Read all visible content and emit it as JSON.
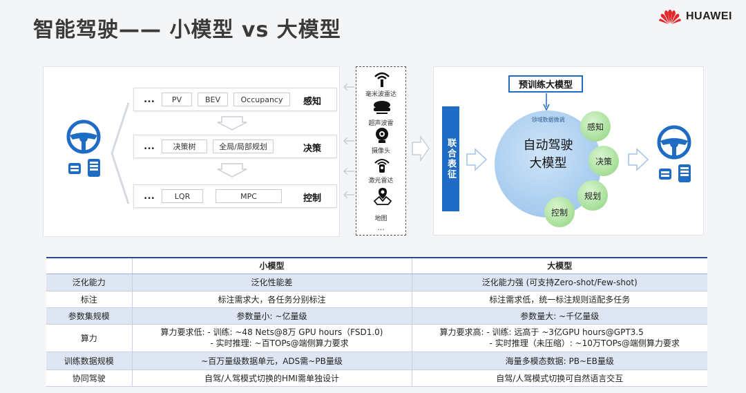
{
  "header": {
    "title": "智能驾驶—— 小模型 vs 大模型",
    "brand": "HUAWEI"
  },
  "small_model_stack": {
    "rows": [
      {
        "dots": "...",
        "chips": [
          "PV",
          "BEV",
          "Occupancy"
        ],
        "label": "感知"
      },
      {
        "dots": "...",
        "chips": [
          "决策树",
          "全局/局部规划"
        ],
        "label": "决策"
      },
      {
        "dots": "...",
        "chips": [
          "LQR",
          "MPC"
        ],
        "label": "控制"
      }
    ]
  },
  "sensors": {
    "items": [
      {
        "label": "毫米波雷达",
        "icon": "radar-icon"
      },
      {
        "label": "超声波雷",
        "icon": "ultrasonic-icon"
      },
      {
        "label": "摄像头",
        "icon": "camera-icon"
      },
      {
        "label": "激光雷达",
        "icon": "lidar-icon"
      },
      {
        "label": "地图",
        "icon": "map-icon"
      }
    ],
    "more": "..."
  },
  "large_model": {
    "joint": "联合表征",
    "pretrain": "预训练大模型",
    "domain_tune": "领域数据微调",
    "title_line1": "自动驾驶",
    "title_line2": "大模型",
    "tasks": [
      "感知",
      "决策",
      "规划",
      "控制"
    ]
  },
  "comparison": {
    "headers": [
      "",
      "小模型",
      "大模型"
    ],
    "rows": [
      {
        "attr": "泛化能力",
        "small": "泛化性能差",
        "large": "泛化能力强 (可支持Zero-shot/Few-shot)"
      },
      {
        "attr": "标注",
        "small": "标注需求大，各任务分别标注",
        "large": "标注需求低，统一标注规则适配多任务"
      },
      {
        "attr": "参数集规模",
        "small": "参数量小: ~亿量级",
        "large": "参数量大: ~千亿量级"
      },
      {
        "attr": "算力",
        "small_line1": "算力要求低: - 训练: ~48 Nets@8万 GPU hours（FSD1.0)",
        "small_line2": "- 实时推理: ~百TOPs@端侧算力要求",
        "large_line1": "算力要求高: - 训练: 远高于 ~3亿GPU hours@GPT3.5",
        "large_line2": "- 实时推理（未压缩）: ~10万TOPs@端侧算力要求"
      },
      {
        "attr": "训练数据规模",
        "small": "~百万量级数据单元，ADS需~PB量级",
        "large": "海量多模态数据: PB~EB量级"
      },
      {
        "attr": "协同驾驶",
        "small": "自驾/人驾模式切换的HMI需单独设计",
        "large": "自驾/人驾模式切换可自然语言交互"
      }
    ]
  },
  "colors": {
    "accent_blue": "#1f6cc4",
    "table_shade": "#dfe6f3",
    "huawei_red": "#e3262a"
  }
}
